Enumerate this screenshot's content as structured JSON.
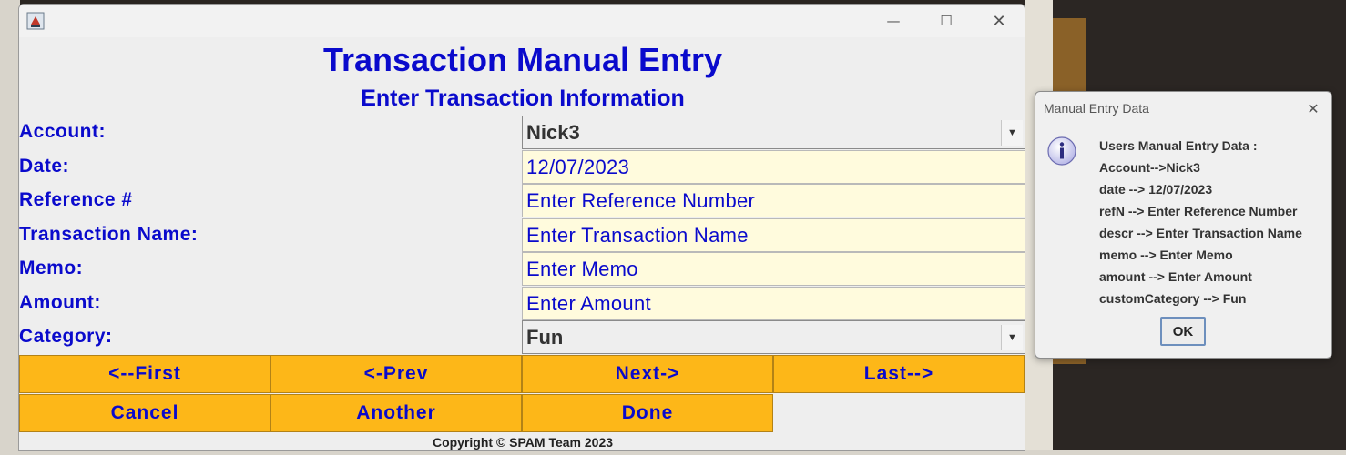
{
  "main_window": {
    "title": "Transaction Manual Entry",
    "subtitle": "Enter Transaction Information",
    "window_controls": {
      "minimize": "—",
      "maximize": "☐",
      "close": "✕"
    },
    "fields": {
      "account": {
        "label": "Account:",
        "value": "Nick3"
      },
      "date": {
        "label": "Date:",
        "value": "12/07/2023"
      },
      "reference": {
        "label": "Reference #",
        "value": "Enter Reference Number"
      },
      "transaction_name": {
        "label": "Transaction Name:",
        "value": "Enter Transaction Name"
      },
      "memo": {
        "label": "Memo:",
        "value": "Enter Memo"
      },
      "amount": {
        "label": "Amount:",
        "value": "Enter Amount"
      },
      "category": {
        "label": "Category:",
        "value": "Fun"
      }
    },
    "buttons": {
      "first": "<--First",
      "prev": "<-Prev",
      "next": "Next->",
      "last": "Last-->",
      "cancel": "Cancel",
      "another": "Another",
      "done": "Done"
    },
    "copyright": "Copyright © SPAM Team 2023"
  },
  "dialog": {
    "title": "Manual Entry Data",
    "close": "✕",
    "lines": [
      "Users Manual Entry Data :",
      "Account-->Nick3",
      "date --> 12/07/2023",
      "refN --> Enter Reference Number",
      "descr --> Enter Transaction Name",
      "memo --> Enter Memo",
      "amount --> Enter Amount",
      "customCategory --> Fun"
    ],
    "ok_label": "OK"
  },
  "colors": {
    "label_blue": "#0a0acc",
    "button_orange": "#fdb718",
    "input_yellow": "#fffbdd",
    "window_bg": "#eeeeee"
  }
}
